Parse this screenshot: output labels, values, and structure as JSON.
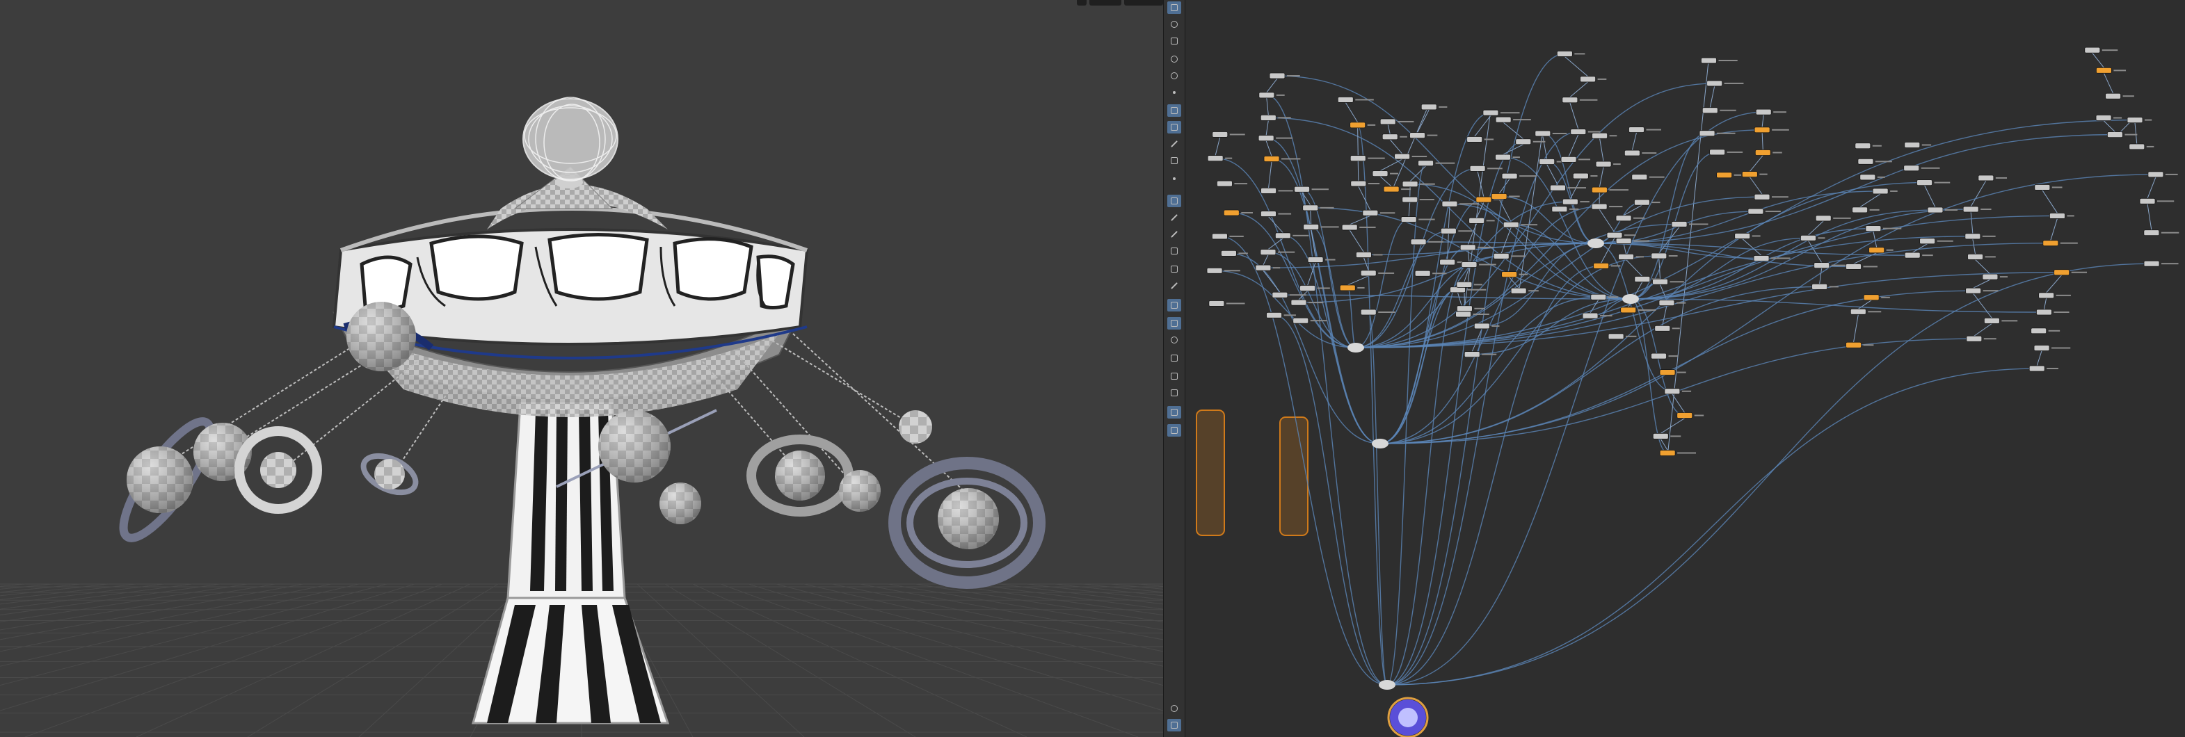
{
  "viewport": {
    "name": "scene-viewport",
    "background": "#3d3d3d",
    "grid_color": "#4a4a4a"
  },
  "toolbar": {
    "tools": [
      {
        "name": "select-tool-icon",
        "active": true
      },
      {
        "name": "transform-tool-icon",
        "active": false
      },
      {
        "name": "lock-icon",
        "active": false
      },
      {
        "name": "scale-tool-icon",
        "active": false
      },
      {
        "name": "rotate-tool-icon",
        "active": false
      },
      {
        "name": "pin-icon",
        "active": false
      },
      {
        "name": "light-icon",
        "active": true
      },
      {
        "name": "camera-icon",
        "active": true
      },
      {
        "name": "magnet-icon",
        "active": false
      },
      {
        "name": "snap-icon",
        "active": false
      },
      {
        "name": "dot-icon",
        "active": false
      },
      {
        "name": "brush-tool-icon",
        "active": true
      },
      {
        "name": "pen-tool-icon",
        "active": false
      },
      {
        "name": "measure-tool-icon",
        "active": false
      },
      {
        "name": "handle-tool-icon",
        "active": false
      },
      {
        "name": "grid-tool-icon",
        "active": false
      },
      {
        "name": "ruler-tool-icon",
        "active": false
      },
      {
        "name": "view-tool-icon",
        "active": true
      },
      {
        "name": "display-tool-icon",
        "active": true
      },
      {
        "name": "shading-tool-icon",
        "active": false
      },
      {
        "name": "texture-tool-icon",
        "active": false
      },
      {
        "name": "particle-tool-icon",
        "active": false
      },
      {
        "name": "background-tool-icon",
        "active": false
      },
      {
        "name": "render-view-icon",
        "active": true
      },
      {
        "name": "visibility-icon",
        "active": true
      },
      {
        "name": "info-icon",
        "active": false
      },
      {
        "name": "layout-grid-icon",
        "active": true
      },
      {
        "name": "settings-icon",
        "active": false
      }
    ]
  },
  "network": {
    "name": "node-network-editor",
    "background": "#2e2e2e",
    "wire_color": "#5b86b8",
    "node_color": "#c9c9c9",
    "highlight_node_color": "#f0a030",
    "group_box_color": "#d07a1a",
    "output_node_color": "#5a4fd8"
  },
  "colors": {
    "accent": "#4f6f94",
    "sphere": "#c8c8c8",
    "ring": "#7a7d8e"
  }
}
